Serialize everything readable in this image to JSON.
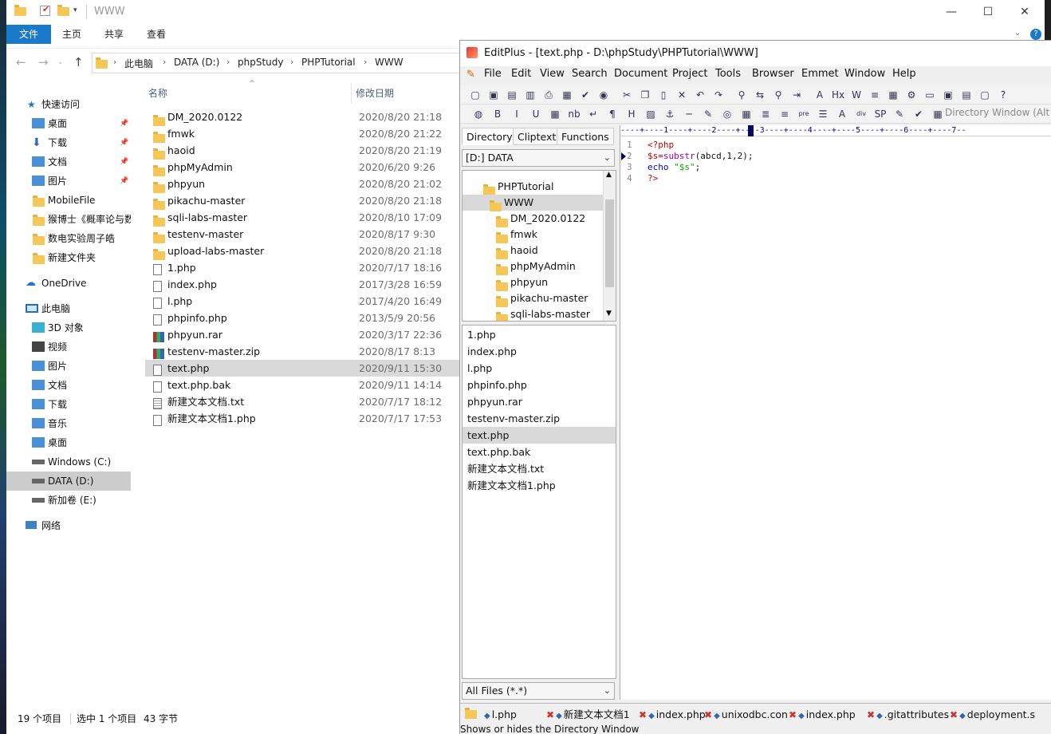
{
  "explorer": {
    "window_title": "WWW",
    "ribbon_tabs": [
      "文件",
      "主页",
      "共享",
      "查看"
    ],
    "address": [
      "此电脑",
      "DATA (D:)",
      "phpStudy",
      "PHPTutorial",
      "WWW"
    ],
    "nav": {
      "quick_access": "快速访问",
      "pinned": [
        "桌面",
        "下载",
        "文档",
        "图片"
      ],
      "folders": [
        "MobileFile",
        "猴博士《概率论与数",
        "数电实验周子皓",
        "新建文件夹"
      ],
      "onedrive": "OneDrive",
      "this_pc": "此电脑",
      "pc_items": [
        "3D 对象",
        "视频",
        "图片",
        "文档",
        "下载",
        "音乐",
        "桌面"
      ],
      "drives": [
        "Windows (C:)",
        "DATA (D:)",
        "新加卷 (E:)"
      ],
      "network": "网络"
    },
    "columns": {
      "name": "名称",
      "date": "修改日期"
    },
    "files": [
      {
        "name": "DM_2020.0122",
        "date": "2020/8/20 21:18",
        "type": "folder"
      },
      {
        "name": "fmwk",
        "date": "2020/8/20 21:22",
        "type": "folder"
      },
      {
        "name": "haoid",
        "date": "2020/8/20 21:19",
        "type": "folder"
      },
      {
        "name": "phpMyAdmin",
        "date": "2020/6/20 9:26",
        "type": "folder"
      },
      {
        "name": "phpyun",
        "date": "2020/8/20 21:02",
        "type": "folder"
      },
      {
        "name": "pikachu-master",
        "date": "2020/8/20 21:18",
        "type": "folder"
      },
      {
        "name": "sqli-labs-master",
        "date": "2020/8/10 17:09",
        "type": "folder"
      },
      {
        "name": "testenv-master",
        "date": "2020/8/17 9:30",
        "type": "folder"
      },
      {
        "name": "upload-labs-master",
        "date": "2020/8/20 21:18",
        "type": "folder"
      },
      {
        "name": "1.php",
        "date": "2020/7/17 18:16",
        "type": "file"
      },
      {
        "name": "index.php",
        "date": "2017/3/28 16:59",
        "type": "file"
      },
      {
        "name": "l.php",
        "date": "2017/4/20 16:49",
        "type": "file"
      },
      {
        "name": "phpinfo.php",
        "date": "2013/5/9 20:56",
        "type": "file"
      },
      {
        "name": "phpyun.rar",
        "date": "2020/3/17 22:36",
        "type": "rar"
      },
      {
        "name": "testenv-master.zip",
        "date": "2020/8/17 8:13",
        "type": "rar"
      },
      {
        "name": "text.php",
        "date": "2020/9/11 15:30",
        "type": "file",
        "selected": true
      },
      {
        "name": "text.php.bak",
        "date": "2020/9/11 14:14",
        "type": "file"
      },
      {
        "name": "新建文本文档.txt",
        "date": "2020/7/17 18:12",
        "type": "txt"
      },
      {
        "name": "新建文本文档1.php",
        "date": "2020/7/17 17:53",
        "type": "file"
      }
    ],
    "status": {
      "count": "19 个项目",
      "selected": "选中 1 个项目",
      "size": "43 字节"
    }
  },
  "editplus": {
    "title": "EditPlus - [text.php - D:\\phpStudy\\PHPTutorial\\WWW]",
    "menu": [
      "File",
      "Edit",
      "View",
      "Search",
      "Document",
      "Project",
      "Tools",
      "Browser",
      "Emmet",
      "Window",
      "Help"
    ],
    "dir_tabs": [
      "Directory",
      "Cliptext",
      "Functions"
    ],
    "drive": "[D:] DATA",
    "tree": [
      "PHPTutorial",
      "WWW",
      "DM_2020.0122",
      "fmwk",
      "haoid",
      "phpMyAdmin",
      "phpyun",
      "pikachu-master",
      "sqli-labs-master"
    ],
    "file_list": [
      "1.php",
      "index.php",
      "l.php",
      "phpinfo.php",
      "phpyun.rar",
      "testenv-master.zip",
      "text.php",
      "text.php.bak",
      "新建文本文档.txt",
      "新建文本文档1.php"
    ],
    "filter": "All Files (*.*)",
    "ruler": "----+----1----+----2----+----3----+----4----+----5----+----6----+----7--",
    "code": [
      {
        "n": "1",
        "parts": [
          {
            "t": "<?php",
            "c": "var"
          }
        ]
      },
      {
        "n": "2",
        "parts": [
          {
            "t": "$s",
            "c": "var"
          },
          {
            "t": "=",
            "c": "var"
          },
          {
            "t": "substr",
            "c": "fn"
          },
          {
            "t": "(abcd,1,2);",
            "c": ""
          }
        ]
      },
      {
        "n": "3",
        "parts": [
          {
            "t": "echo ",
            "c": "kw"
          },
          {
            "t": "\"$s\"",
            "c": "str"
          },
          {
            "t": ";",
            "c": ""
          }
        ]
      },
      {
        "n": "4",
        "parts": [
          {
            "t": "?>",
            "c": "var"
          }
        ]
      }
    ],
    "file_tabs": [
      "l.php",
      "新建文本文档1",
      "index.php",
      "unixodbc.con",
      "index.php",
      ".gitattributes",
      "deployment.s"
    ],
    "toolbar_hint": "Directory Window (Alt",
    "status": "Shows or hides the Directory Window"
  },
  "colors": {
    "accent": "#1979ca",
    "selection": "#d9d9d9"
  }
}
